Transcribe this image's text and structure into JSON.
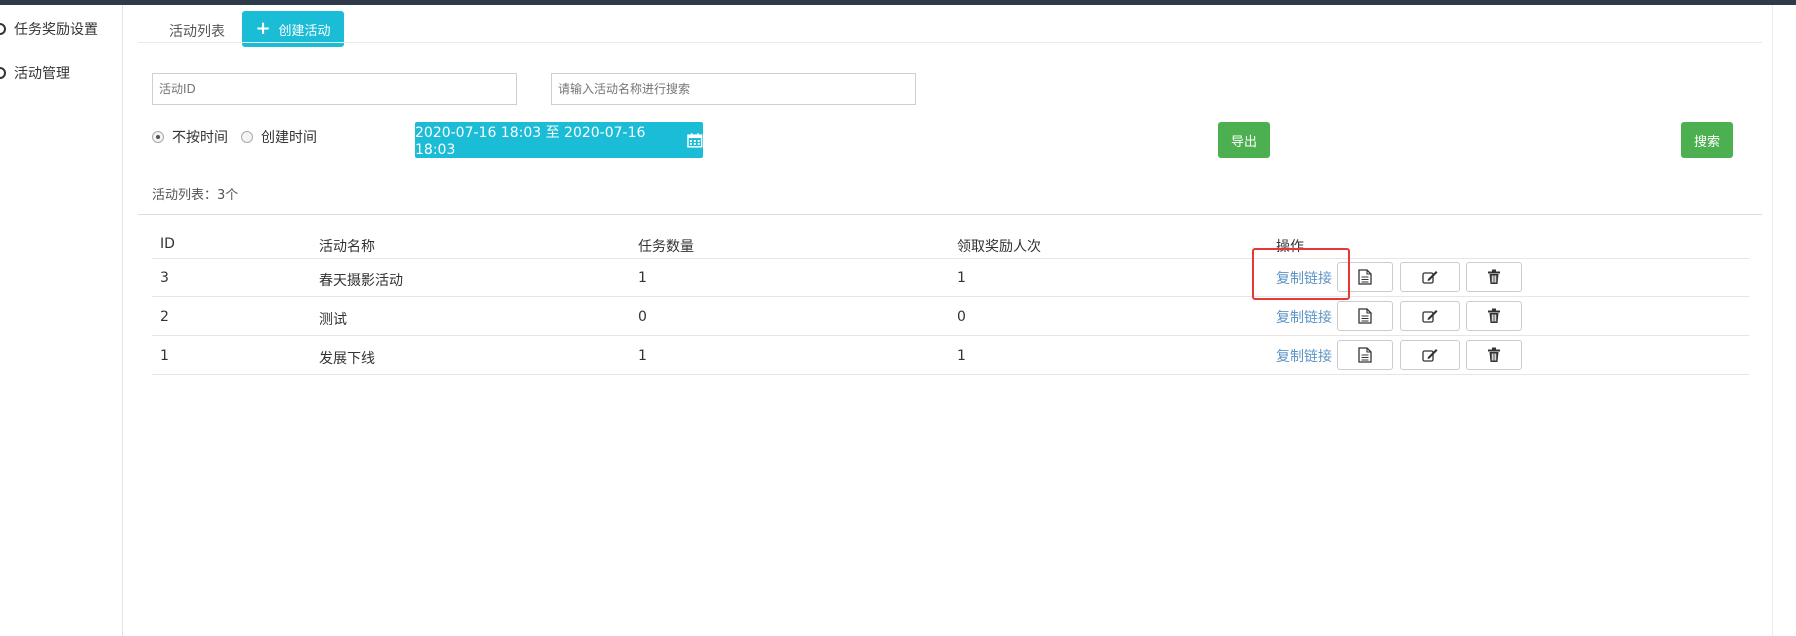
{
  "sidebar": {
    "items": [
      {
        "label": "任务奖励设置"
      },
      {
        "label": "活动管理"
      }
    ]
  },
  "tabs": {
    "list_label": "活动列表",
    "create_label": "创建活动"
  },
  "filters": {
    "activity_id_placeholder": "活动ID",
    "activity_name_placeholder": "请输入活动名称进行搜索",
    "time_options": [
      {
        "label": "不按时间",
        "selected": true
      },
      {
        "label": "创建时间",
        "selected": false
      }
    ],
    "date_range": "2020-07-16 18:03 至 2020-07-16 18:03",
    "export_label": "导出",
    "search_label": "搜索"
  },
  "list": {
    "count_text": "活动列表：3个",
    "headers": [
      "ID",
      "活动名称",
      "任务数量",
      "领取奖励人次",
      "操作"
    ],
    "rows": [
      {
        "id": "3",
        "name": "春天摄影活动",
        "task_count": "1",
        "reward_count": "1",
        "copy_link": "复制链接"
      },
      {
        "id": "2",
        "name": "测试",
        "task_count": "0",
        "reward_count": "0",
        "copy_link": "复制链接"
      },
      {
        "id": "1",
        "name": "发展下线",
        "task_count": "1",
        "reward_count": "1",
        "copy_link": "复制链接"
      }
    ],
    "action_icons": [
      "document-icon",
      "edit-icon",
      "trash-icon"
    ]
  },
  "colors": {
    "accent_cyan": "#1abcd6",
    "accent_green": "#4cb050",
    "link_blue": "#5d94c6",
    "highlight_red": "#e53935"
  }
}
